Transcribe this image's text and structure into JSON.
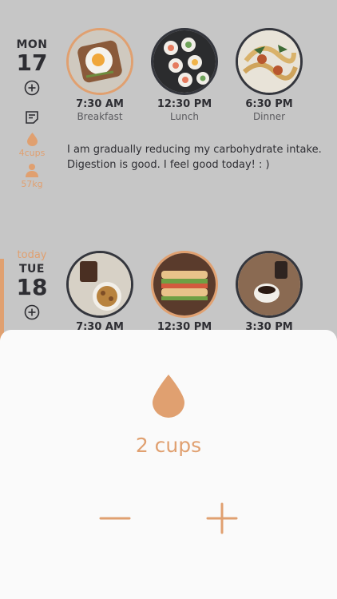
{
  "days": [
    {
      "today_label": "",
      "weekday": "MON",
      "date": "17",
      "water": "4cups",
      "weight": "57kg",
      "note": "I am gradually reducing my carbohydrate intake. Digestion is good. I feel good today! : )",
      "meals": [
        {
          "time": "7:30 AM",
          "label": "Breakfast"
        },
        {
          "time": "12:30 PM",
          "label": "Lunch"
        },
        {
          "time": "6:30 PM",
          "label": "Dinner"
        }
      ]
    },
    {
      "today_label": "today",
      "weekday": "TUE",
      "date": "18",
      "meals": [
        {
          "time": "7:30 AM",
          "label": ""
        },
        {
          "time": "12:30 PM",
          "label": ""
        },
        {
          "time": "3:30 PM",
          "label": ""
        }
      ]
    }
  ],
  "sheet": {
    "value": "2 cups",
    "icons": [
      "water-drop",
      "minus",
      "plus"
    ]
  },
  "colors": {
    "accent": "#e0a070",
    "dark": "#34363d",
    "background": "#c6c6c6",
    "sheet": "#fafafa"
  }
}
